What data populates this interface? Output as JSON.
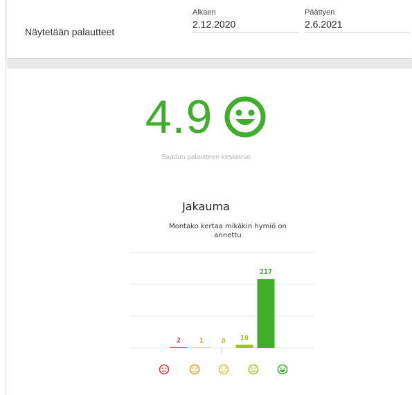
{
  "filter": {
    "title": "Näytetään palautteet",
    "start_label": "Alkaen",
    "start_value": "2.12.2020",
    "end_label": "Päättyen",
    "end_value": "2.6.2021"
  },
  "summary": {
    "average": "4.9",
    "caption": "Saadun palautteen keskiarvo",
    "icon": "smiley-happy-icon",
    "color": "#3fae2a"
  },
  "chart_data": {
    "type": "bar",
    "title": "Jakauma",
    "subtitle": "Montako kertaa mikäkin hymiö on annettu",
    "categories": [
      "very-sad-face-icon",
      "sad-face-icon",
      "neutral-face-icon",
      "happy-face-icon",
      "very-happy-face-icon"
    ],
    "values": [
      2,
      1,
      0,
      10,
      217
    ],
    "colors": [
      "#dd3333",
      "#e99a2c",
      "#d3c134",
      "#9cc41f",
      "#3fae2a"
    ],
    "ylim": [
      0,
      300
    ],
    "grid": true
  }
}
